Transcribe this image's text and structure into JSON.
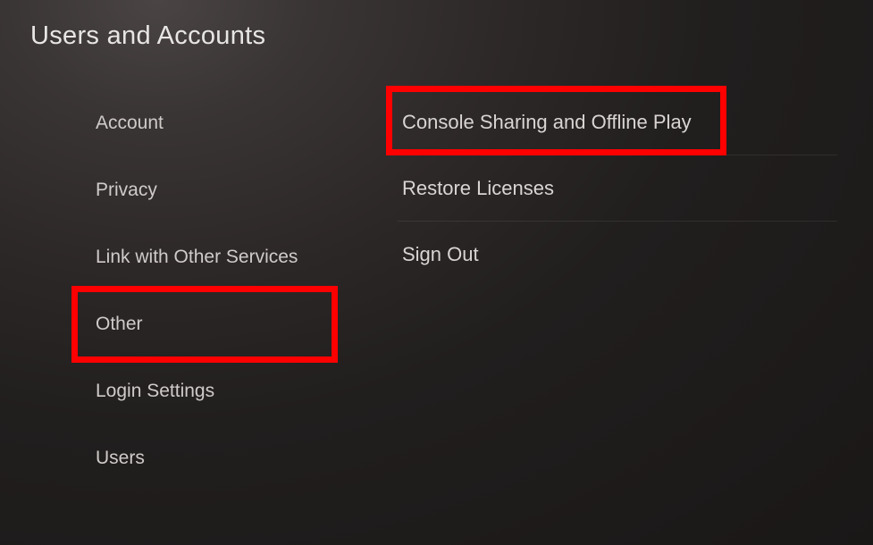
{
  "title": "Users and Accounts",
  "sidebar": {
    "items": [
      {
        "label": "Account"
      },
      {
        "label": "Privacy"
      },
      {
        "label": "Link with Other Services"
      },
      {
        "label": "Other"
      },
      {
        "label": "Login Settings"
      },
      {
        "label": "Users"
      }
    ]
  },
  "main": {
    "items": [
      {
        "label": "Console Sharing and Offline Play"
      },
      {
        "label": "Restore Licenses"
      },
      {
        "label": "Sign Out"
      }
    ]
  }
}
